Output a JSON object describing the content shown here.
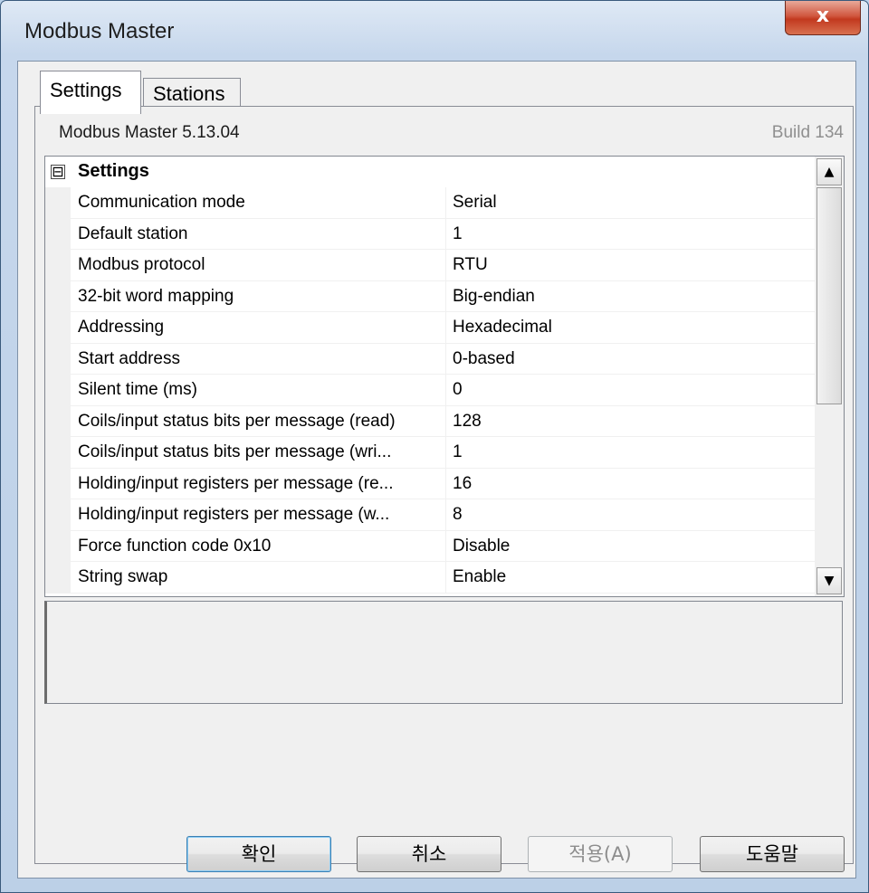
{
  "window": {
    "title": "Modbus Master",
    "close_label": "x"
  },
  "tabs": [
    {
      "label": "Settings",
      "active": true
    },
    {
      "label": "Stations",
      "active": false
    }
  ],
  "header": {
    "name": "Modbus Master 5.13.04",
    "build": "Build 134"
  },
  "grid": {
    "category": {
      "toggle": "⊟",
      "label": "Settings"
    },
    "rows": [
      {
        "name": "Communication mode",
        "value": "Serial"
      },
      {
        "name": "Default station",
        "value": "1"
      },
      {
        "name": "Modbus protocol",
        "value": "RTU"
      },
      {
        "name": "32-bit word mapping",
        "value": "Big-endian"
      },
      {
        "name": "Addressing",
        "value": "Hexadecimal"
      },
      {
        "name": "Start address",
        "value": "0-based"
      },
      {
        "name": "Silent time (ms)",
        "value": "0"
      },
      {
        "name": "Coils/input status bits per message (read)",
        "value": "128"
      },
      {
        "name": "Coils/input status bits per message (wri...",
        "value": "1"
      },
      {
        "name": "Holding/input registers per message (re...",
        "value": "16"
      },
      {
        "name": "Holding/input registers per message (w...",
        "value": "8"
      },
      {
        "name": "Force function code 0x10",
        "value": "Disable"
      },
      {
        "name": "String swap",
        "value": "Enable"
      }
    ],
    "scroll_up_icon": "▲",
    "scroll_down_icon": "▼"
  },
  "buttons": {
    "ok": "확인",
    "cancel": "취소",
    "apply": "적용(A)",
    "help": "도움말"
  }
}
